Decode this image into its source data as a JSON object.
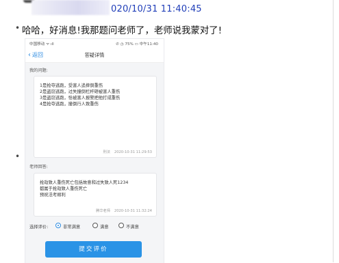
{
  "chat": {
    "timestamp": "020/10/31 11:40:45",
    "message": "哈哈，好消息!我那题问老师了，老师说我蒙对了!",
    "bullet": "•"
  },
  "phone": {
    "status": {
      "carrier": "中国移动 ᯤ ıll",
      "right": "✆ ◷ 75% ▭ 中午11:40"
    },
    "nav": {
      "back_label": "返回",
      "title": "答疑详情"
    },
    "question": {
      "label": "我的问题:",
      "lines": [
        "1是抢夺逃跑，受害人追摔倒重伤",
        "2是盗窃逃跑，过失撞倒栏杆砸被害人重伤",
        "3是盗窃逃跑，恰被害人报警把他打成重伤",
        "4是抢夺逃跑，撞倒行人致重伤"
      ],
      "author": "刑法",
      "time": "2020-10-31 11:29:53"
    },
    "answer": {
      "label": "老师回答:",
      "lines": [
        "抢劫致人重伤死亡包括故意和过失致人死1234",
        "都属于抢劫致人重伤死亡",
        "预祝法考顺利"
      ],
      "author": "腾华老师",
      "time": "2020-10-31 11:32:24"
    },
    "rating": {
      "label": "选择评价:",
      "options": [
        {
          "label": "非常满意",
          "selected": true
        },
        {
          "label": "满意",
          "selected": false
        },
        {
          "label": "不满意",
          "selected": false
        }
      ]
    },
    "submit_label": "提交评价"
  },
  "colors": {
    "accent": "#2a93e6",
    "timestamp": "#1f3db8"
  }
}
